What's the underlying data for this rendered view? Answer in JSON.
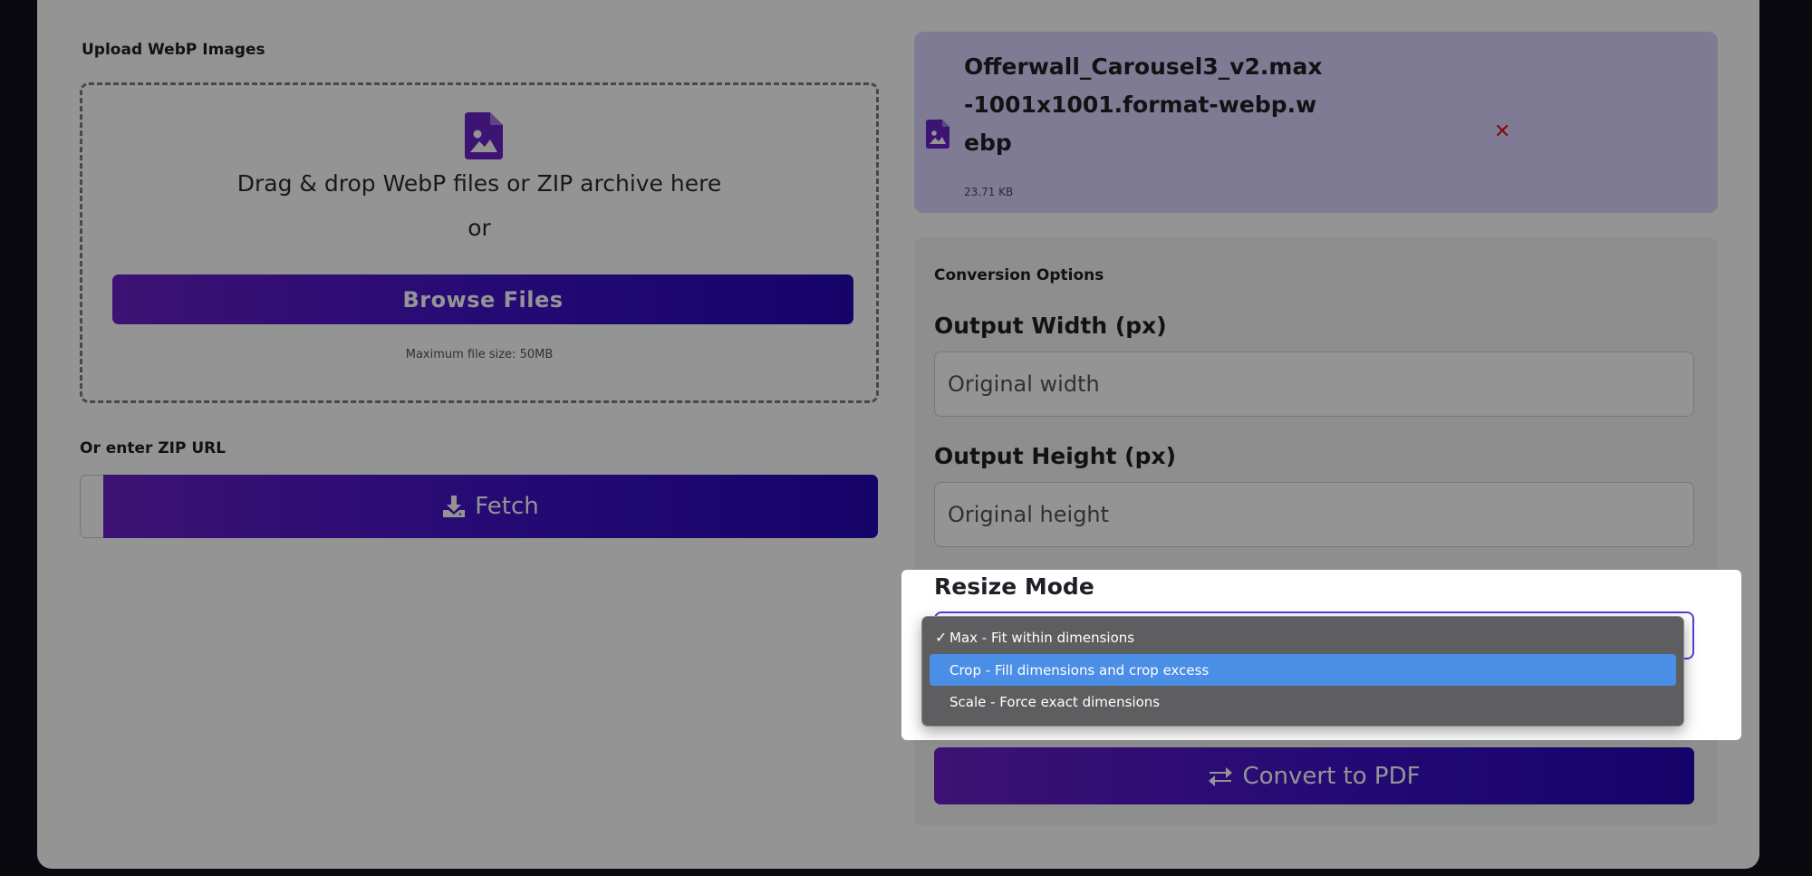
{
  "upload": {
    "section_label": "Upload WebP Images",
    "drop_text": "Drag & drop WebP files or ZIP archive here",
    "or_text": "or",
    "browse_label": "Browse Files",
    "max_size": "Maximum file size: 50MB"
  },
  "zip": {
    "section_label": "Or enter ZIP URL",
    "url_value": "",
    "fetch_label": "Fetch"
  },
  "file": {
    "name": "Offerwall_Carousel3_v2.max-1001x1001.format-webp.webp",
    "size": "23.71 KB",
    "remove_symbol": "✕"
  },
  "options": {
    "title": "Conversion Options",
    "width_label": "Output Width (px)",
    "width_placeholder": "Original width",
    "height_label": "Output Height (px)",
    "height_placeholder": "Original height",
    "resize_label": "Resize Mode",
    "resize_options": [
      "Max - Fit within dimensions",
      "Crop - Fill dimensions and crop excess",
      "Scale - Force exact dimensions"
    ],
    "check_symbol": "✓",
    "convert_label": "Convert to PDF"
  },
  "colors": {
    "accent_start": "#6a1fc8",
    "accent_end": "#2606b5",
    "file_card_bg": "#ddd5ff",
    "remove": "#e0161b",
    "menu_highlight": "#4a8ee6"
  }
}
